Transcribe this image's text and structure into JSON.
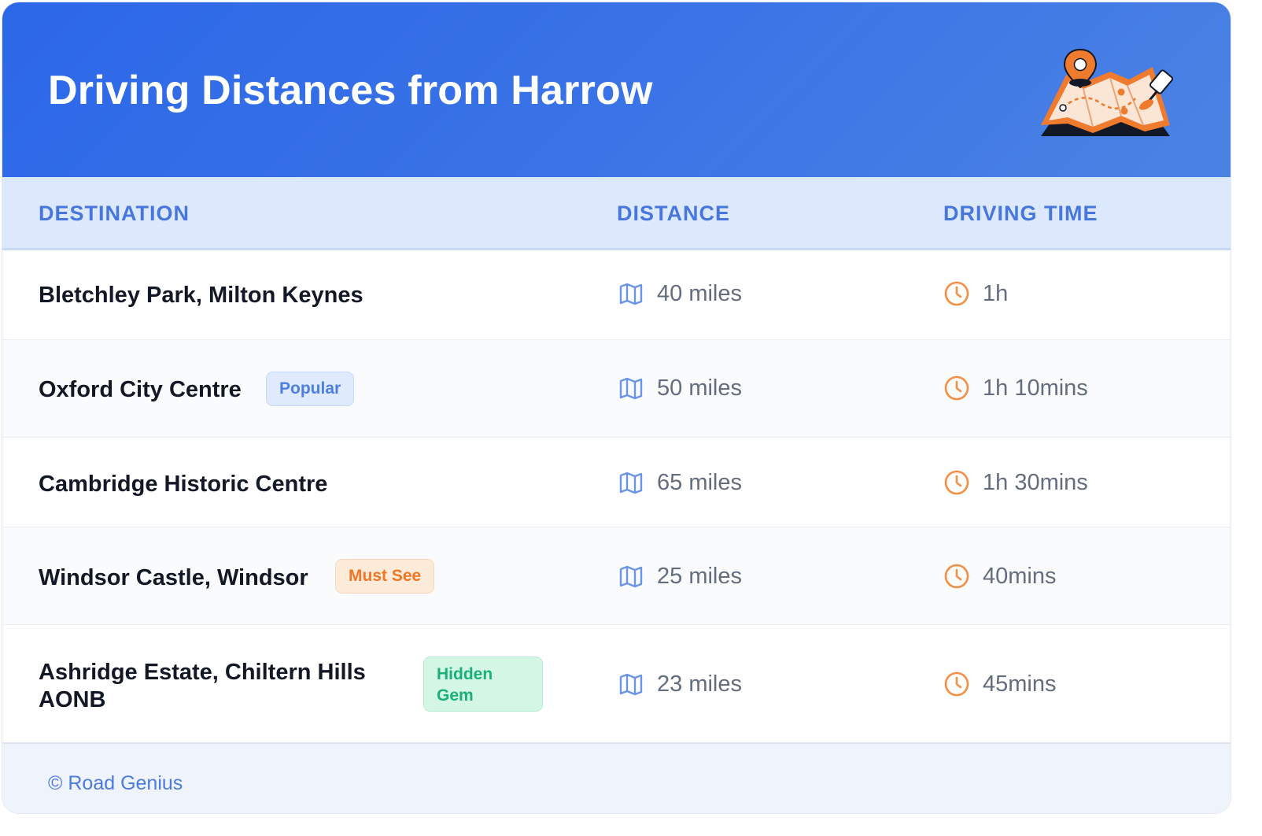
{
  "header": {
    "title": "Driving Distances from Harrow",
    "illustration_icon": "folded-map-with-pin-icon"
  },
  "columns": {
    "destination": "DESTINATION",
    "distance": "DISTANCE",
    "driving_time": "DRIVING TIME"
  },
  "rows": [
    {
      "destination": "Bletchley Park, Milton Keynes",
      "badge": "",
      "distance": "40 miles",
      "time": "1h"
    },
    {
      "destination": "Oxford City Centre",
      "badge": "Popular",
      "distance": "50 miles",
      "time": "1h 10mins"
    },
    {
      "destination": "Cambridge Historic Centre",
      "badge": "",
      "distance": "65 miles",
      "time": "1h 30mins"
    },
    {
      "destination": "Windsor Castle, Windsor",
      "badge": "Must See",
      "distance": "25 miles",
      "time": "40mins"
    },
    {
      "destination": "Ashridge Estate, Chiltern Hills AONB",
      "badge": "Hidden Gem",
      "distance": "23 miles",
      "time": "45mins"
    }
  ],
  "icons": {
    "distance": "map-icon",
    "time": "clock-icon"
  },
  "colors": {
    "header_blue": "#2c67e8",
    "accent_orange": "#ee7626",
    "badge_green": "#19b07a"
  },
  "footer": {
    "credit": "© Road Genius"
  }
}
